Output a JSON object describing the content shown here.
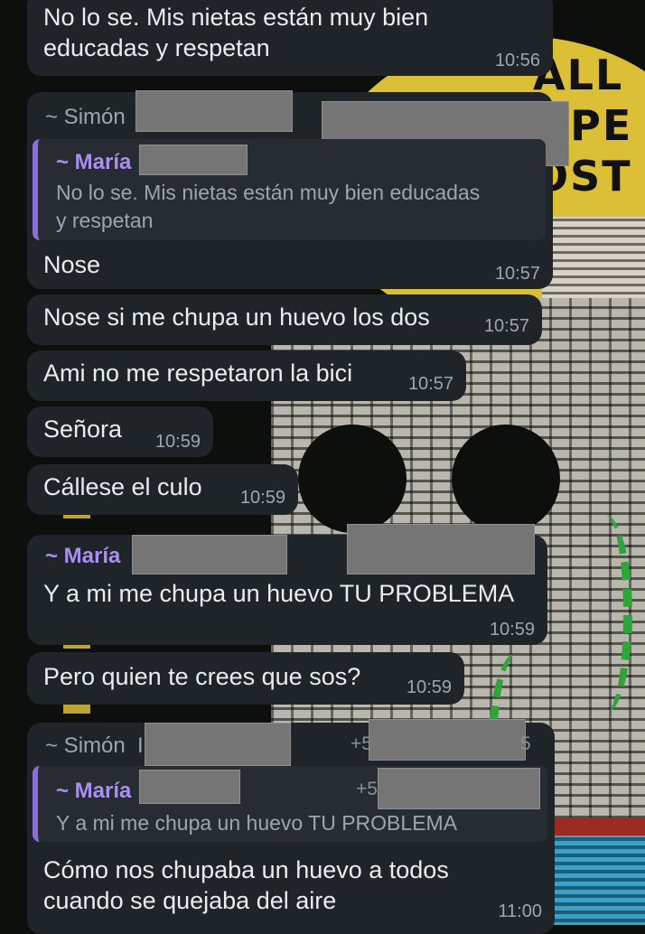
{
  "messages": [
    {
      "text_lines": [
        "No lo se. Mis nietas están muy bien",
        "educadas y respetan"
      ],
      "time": "10:56"
    },
    {
      "sender": "~ Simón",
      "reply_to": {
        "sender": "~ María",
        "text_lines": [
          "No lo se. Mis nietas están muy bien educadas",
          "y respetan"
        ]
      },
      "text": "Nose",
      "time": "10:57"
    },
    {
      "text": "Nose si me chupa un huevo los dos",
      "time": "10:57"
    },
    {
      "text": "Ami no me respetaron la bici",
      "time": "10:57"
    },
    {
      "text": "Señora",
      "time": "10:59"
    },
    {
      "text": "Cállese el culo",
      "time": "10:59"
    },
    {
      "sender": "~ María",
      "text": "Y a mi me chupa un huevo TU PROBLEMA",
      "time": "10:59"
    },
    {
      "text": "Pero quien te crees que sos?",
      "time": "10:59"
    },
    {
      "sender": "~ Simón",
      "sender_frag": "I",
      "phone_frag": "+5",
      "phone_frag_end": "5",
      "reply_to": {
        "sender": "~ María",
        "phone_frag": "+5",
        "text": "Y a mi me chupa un huevo TU PROBLEMA"
      },
      "text_lines": [
        "Cómo nos chupaba un huevo a todos",
        "cuando se quejaba del aire"
      ],
      "time": "11:00"
    }
  ],
  "wallpaper": {
    "text": "ALL\nOPE\nOST",
    "colors": {
      "sun": "#e7c93a",
      "vine": "#2ea43a",
      "bubble": "#1f2428",
      "quote_bar": "#8a6fd8",
      "name": "#a98ff0"
    }
  }
}
